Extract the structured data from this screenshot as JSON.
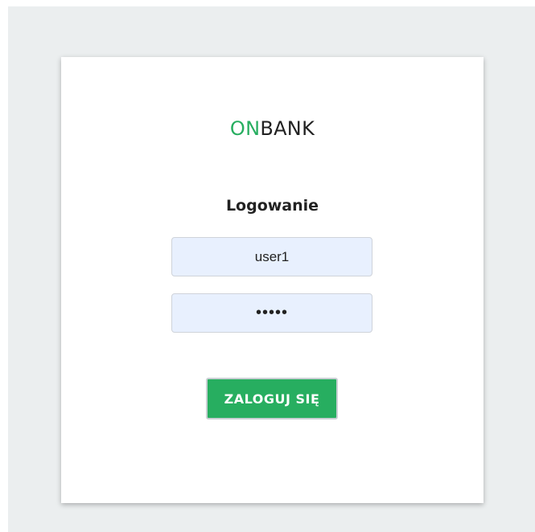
{
  "logo": {
    "accent": "ON",
    "rest": "BANK",
    "accent_color": "#27ae60"
  },
  "login": {
    "title": "Logowanie",
    "username_value": "user1",
    "password_value": "•••••",
    "submit_label": "ZALOGUJ SIĘ",
    "button_color": "#27ae60"
  }
}
